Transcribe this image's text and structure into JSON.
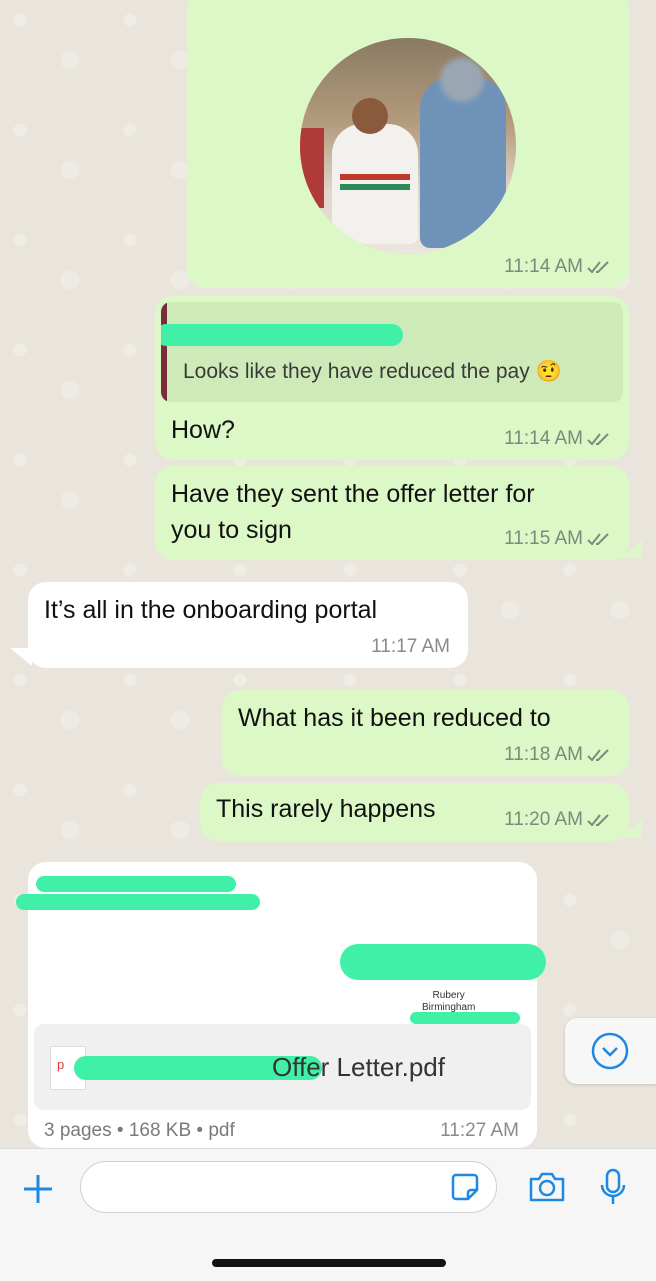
{
  "top_header_text": "",
  "messages": {
    "image_msg": {
      "time": "11:14 AM"
    },
    "quote_msg": {
      "quoted_text": "Looks like they have reduced the pay",
      "quoted_emoji": "🤨",
      "text": "How?",
      "time": "11:14 AM"
    },
    "msg_offer": {
      "line1": "Have they sent the offer letter for",
      "line2": "you to sign",
      "time": "11:15 AM"
    },
    "msg_portal": {
      "text": "It’s all in the onboarding portal",
      "time": "11:17 AM"
    },
    "msg_reduced": {
      "text": "What has it been reduced to",
      "time": "11:18 AM"
    },
    "msg_rarely": {
      "text": "This rarely happens",
      "time": "11:20 AM"
    },
    "doc_msg": {
      "preview_line1": "Rubery",
      "preview_line2": "Birmingham",
      "file_name": "Offer Letter.pdf",
      "pdf_badge": "p",
      "meta": "3 pages • 168 KB • pdf",
      "time": "11:27 AM"
    }
  },
  "colors": {
    "outgoing": "#dcf8c6",
    "incoming": "#ffffff",
    "background": "#e9e4dc",
    "accent": "#1e88e5",
    "redaction": "#3ff0a6"
  },
  "icons": {
    "plus": "plus-icon",
    "sticker": "sticker-icon",
    "camera": "camera-icon",
    "mic": "microphone-icon",
    "scroll": "scroll-down-icon"
  }
}
